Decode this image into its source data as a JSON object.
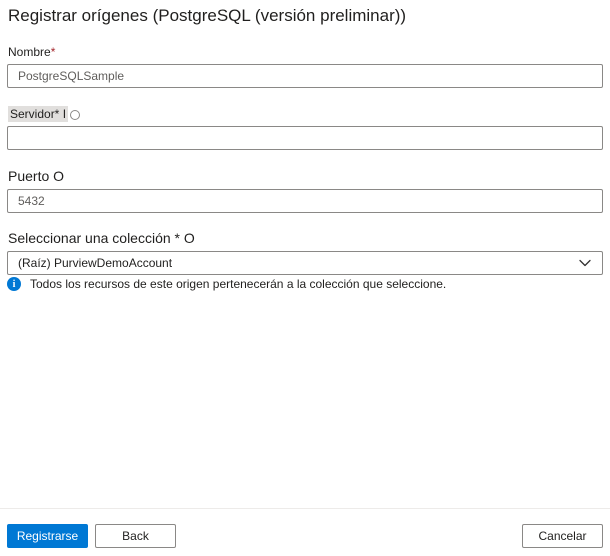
{
  "panel": {
    "title": "Registrar orígenes (PostgreSQL (versión preliminar))"
  },
  "fields": {
    "name": {
      "label": "Nombre",
      "required_marker": "*",
      "value": "PostgreSQLSample"
    },
    "server": {
      "label": "Servidor*",
      "suffix": "I",
      "value": ""
    },
    "port": {
      "label": "Puerto O",
      "value": "5432"
    },
    "collection": {
      "label": "Seleccionar una colección * O",
      "selected": "(Raíz) PurviewDemoAccount",
      "info": "Todos los recursos de este origen pertenecerán a la colección que seleccione."
    }
  },
  "buttons": {
    "register": "Registrarse",
    "back": "Back",
    "cancel": "Cancelar"
  },
  "colors": {
    "primary": "#0078d4",
    "required": "#a4262c",
    "border": "#8a8886"
  },
  "icons": {
    "info": "info-icon",
    "dropdown": "chevron-down-icon"
  }
}
